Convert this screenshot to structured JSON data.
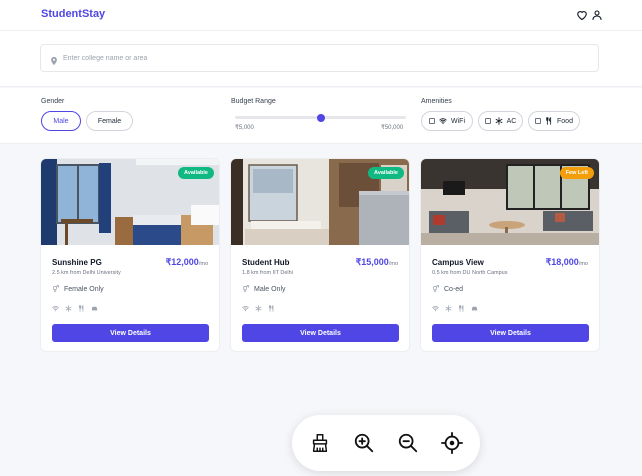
{
  "app": {
    "logo": "StudentStay"
  },
  "header": {
    "icons": [
      "heart-icon",
      "user-icon"
    ]
  },
  "search": {
    "placeholder": "Enter college name or area",
    "value": ""
  },
  "filters": {
    "gender": {
      "label": "Gender",
      "options": [
        "Male",
        "Female"
      ],
      "selected": "Male"
    },
    "budget": {
      "label": "Budget Range",
      "min_label": "₹5,000",
      "max_label": "₹50,000",
      "min": 5000,
      "max": 50000,
      "value_fraction": 0.5
    },
    "amenities": {
      "label": "Amenities",
      "options": [
        "WiFi",
        "AC",
        "Food"
      ],
      "checked": []
    }
  },
  "listings": [
    {
      "name": "Sunshine PG",
      "price": "₹12,000",
      "unit": "/mo",
      "distance": "2.5 km from Delhi University",
      "gender": "Female Only",
      "badge": "Available",
      "badge_color": "#10b981",
      "amenity_icons": [
        "wifi-icon",
        "snowflake-icon",
        "utensils-icon",
        "car-icon"
      ],
      "button": "View Details"
    },
    {
      "name": "Student Hub",
      "price": "₹15,000",
      "unit": "/mo",
      "distance": "1.8 km from IIT Delhi",
      "gender": "Male Only",
      "badge": "Available",
      "badge_color": "#10b981",
      "amenity_icons": [
        "wifi-icon",
        "snowflake-icon",
        "utensils-icon"
      ],
      "button": "View Details"
    },
    {
      "name": "Campus View",
      "price": "₹18,000",
      "unit": "/mo",
      "distance": "0.5 km from DU North Campus",
      "gender": "Co-ed",
      "badge": "Few Left",
      "badge_color": "#f59e0b",
      "amenity_icons": [
        "wifi-icon",
        "snowflake-icon",
        "utensils-icon",
        "car-icon"
      ],
      "button": "View Details"
    }
  ],
  "toolbar": {
    "icons": [
      "broom-icon",
      "zoom-in-icon",
      "zoom-out-icon",
      "locate-icon"
    ]
  },
  "colors": {
    "accent": "#4f46e5",
    "available": "#10b981",
    "few_left": "#f59e0b",
    "background": "#f6f7fa"
  }
}
